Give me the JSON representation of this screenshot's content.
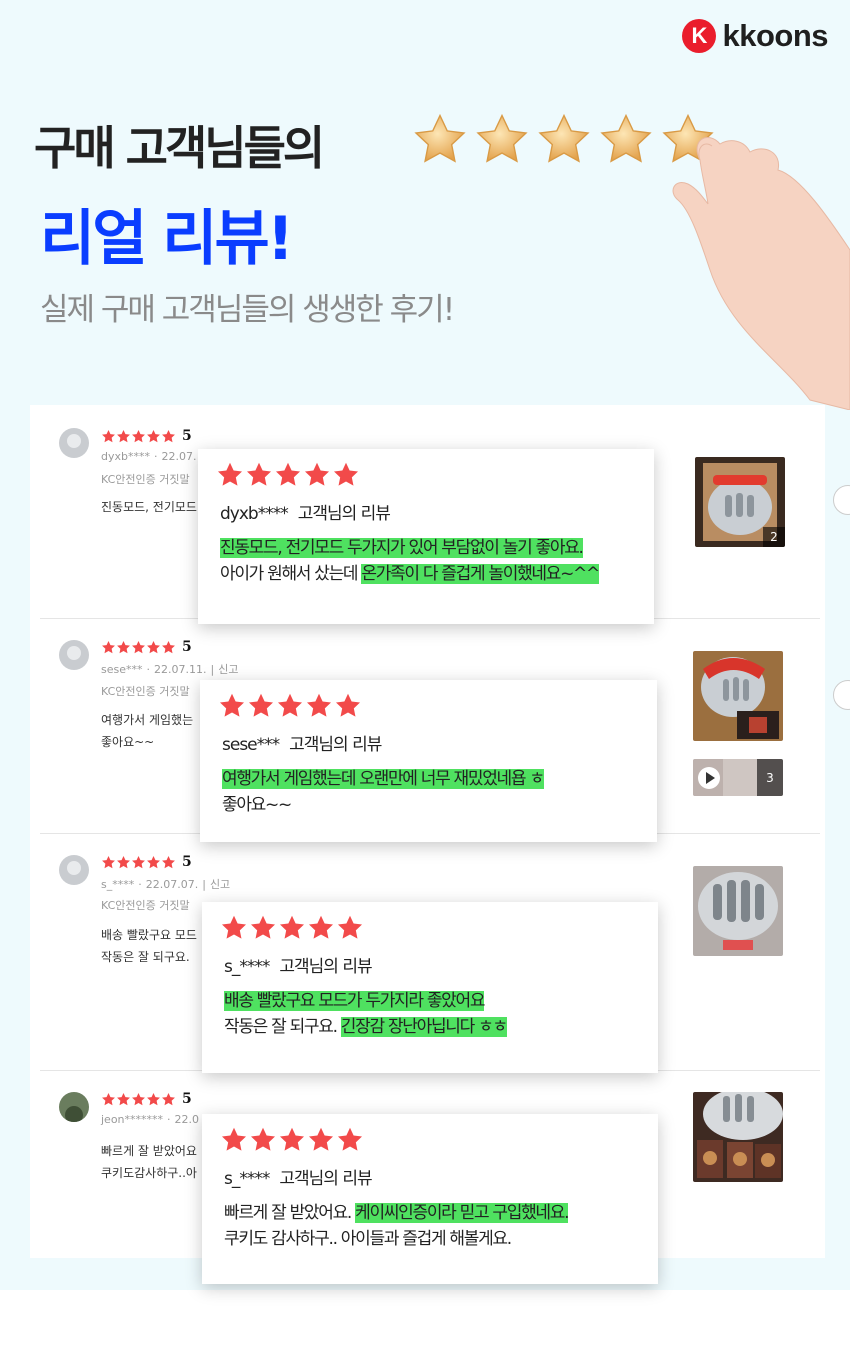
{
  "brand": {
    "mark": "K",
    "name": "kkoons"
  },
  "hero": {
    "title_line1": "구매 고객님들의",
    "title_line2": "리얼 리뷰!",
    "subtitle": "실제 구매 고객님들의 생생한 후기!"
  },
  "colors": {
    "accent_blue": "#0a3dff",
    "star_red": "#f24a4a",
    "highlight_green": "#4fe160",
    "brand_red": "#ea1d2c",
    "star_gold": "#f1c16b"
  },
  "icons": [
    "gold-star-icon",
    "red-star-icon",
    "user-avatar-icon",
    "play-icon"
  ],
  "reviews": [
    {
      "score": "5",
      "user": "dyxb****",
      "date": "22.07.",
      "report": "",
      "kc": "KC안전인증 거짓말",
      "body_lines": [
        "진동모드, 전기모드"
      ],
      "thumb_badge": "2",
      "card": {
        "user": "dyxb****",
        "suffix": "고객님의 리뷰",
        "lines": [
          [
            {
              "t": "진동모드, 전기모드 두가지가 있어 부담없이 놀기 좋아요.",
              "hl": true
            }
          ],
          [
            {
              "t": "아이가 원해서 샀는데 ",
              "hl": false
            },
            {
              "t": "온가족이 다 즐겁게 놀이했네요~^^",
              "hl": true
            }
          ]
        ]
      }
    },
    {
      "score": "5",
      "user": "sese***",
      "date": "22.07.11.",
      "report": "신고",
      "kc": "KC안전인증 거짓말",
      "body_lines": [
        "여행가서 게임했는",
        "좋아요~~"
      ],
      "thumb_badge": "3",
      "card": {
        "user": "sese***",
        "suffix": "고객님의 리뷰",
        "lines": [
          [
            {
              "t": "여행가서 게임했는데 오랜만에 너무 재밌었네욥 ㅎ",
              "hl": true
            }
          ],
          [
            {
              "t": "좋아요~~",
              "hl": false
            }
          ]
        ]
      }
    },
    {
      "score": "5",
      "user": "s_****",
      "date": "22.07.07.",
      "report": "신고",
      "kc": "KC안전인증 거짓말",
      "body_lines": [
        "배송 빨랐구요 모드",
        "작동은 잘 되구요."
      ],
      "thumb_badge": "",
      "card": {
        "user": "s_****",
        "suffix": "고객님의 리뷰",
        "lines": [
          [
            {
              "t": "배송 빨랐구요 모드가 두가지라 좋았어요",
              "hl": true
            }
          ],
          [
            {
              "t": "작동은 잘 되구요. ",
              "hl": false
            },
            {
              "t": "긴장감 장난아닙니다 ㅎㅎ",
              "hl": true
            }
          ]
        ]
      }
    },
    {
      "score": "5",
      "user": "jeon*******",
      "date": "22.0",
      "report": "",
      "kc": "",
      "body_lines": [
        "빠르게 잘  받았어요",
        "쿠키도감사하구..아"
      ],
      "thumb_badge": "",
      "card": {
        "user": "s_****",
        "suffix": "고객님의 리뷰",
        "lines": [
          [
            {
              "t": "빠르게 잘 받았어요. ",
              "hl": false
            },
            {
              "t": "케이씨인증이라 믿고 구입했네요.",
              "hl": true
            }
          ],
          [
            {
              "t": "쿠키도 감사하구.. 아이들과 즐겁게 해볼게요.",
              "hl": false
            }
          ]
        ]
      }
    }
  ]
}
